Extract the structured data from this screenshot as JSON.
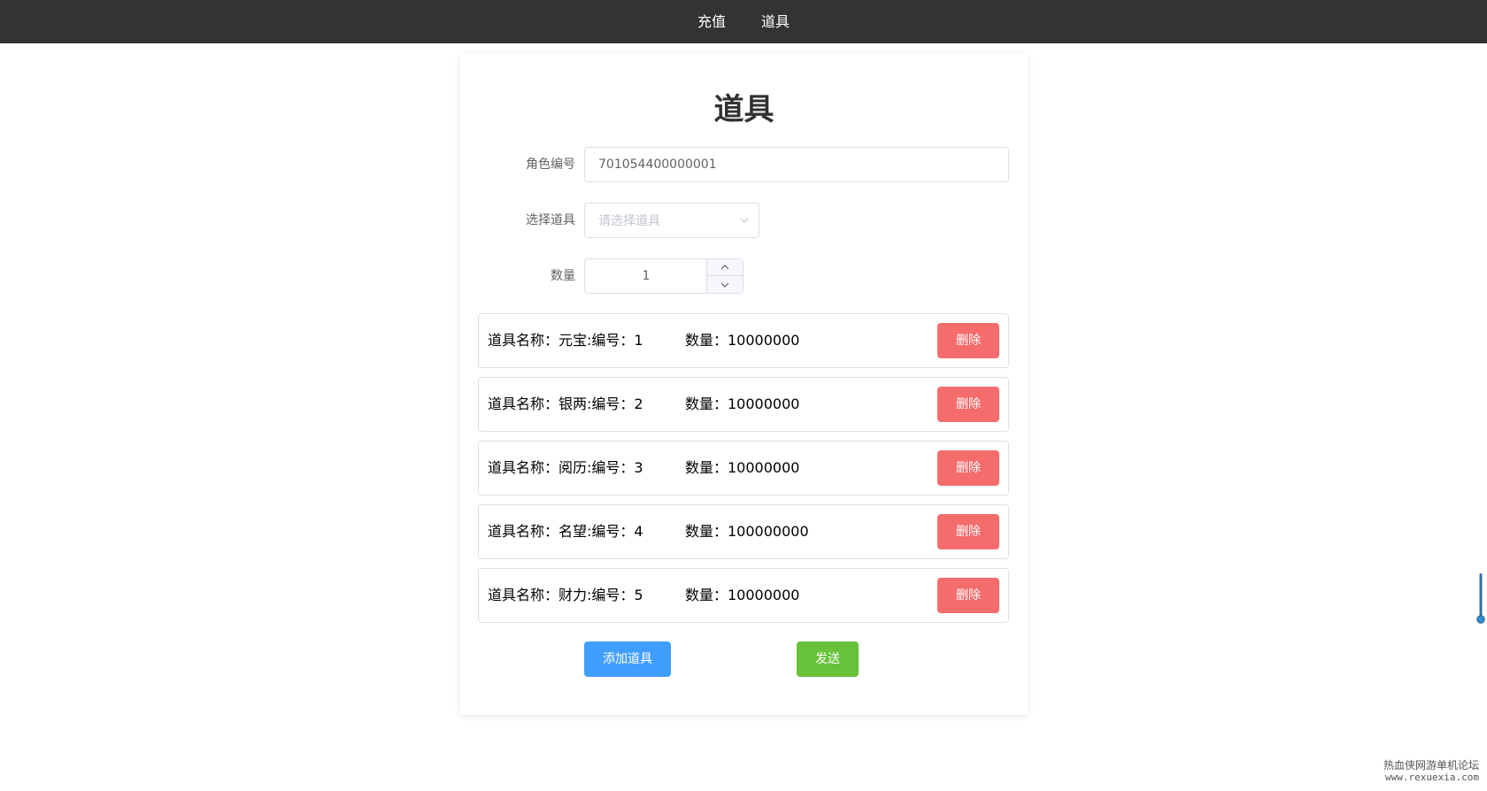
{
  "nav": {
    "items": [
      {
        "label": "充值"
      },
      {
        "label": "道具"
      }
    ]
  },
  "page": {
    "title": "道具"
  },
  "form": {
    "role_label": "角色编号",
    "role_value": "701054400000001",
    "prop_label": "选择道具",
    "prop_placeholder": "请选择道具",
    "qty_label": "数量",
    "qty_value": "1"
  },
  "items": [
    {
      "name": "道具名称：元宝:编号：1",
      "qty": "数量：10000000",
      "delete_label": "删除"
    },
    {
      "name": "道具名称：银两:编号：2",
      "qty": "数量：10000000",
      "delete_label": "删除"
    },
    {
      "name": "道具名称：阅历:编号：3",
      "qty": "数量：10000000",
      "delete_label": "删除"
    },
    {
      "name": "道具名称：名望:编号：4",
      "qty": "数量：100000000",
      "delete_label": "删除"
    },
    {
      "name": "道具名称：财力:编号：5",
      "qty": "数量：10000000",
      "delete_label": "删除"
    }
  ],
  "actions": {
    "add_label": "添加道具",
    "send_label": "发送"
  },
  "watermark": {
    "line1": "热血侠网游单机论坛",
    "line2": "www.rexuexia.com"
  },
  "colors": {
    "nav_bg": "#333333",
    "danger": "#f56c6c",
    "primary": "#409eff",
    "success": "#67c23a"
  },
  "icons": {
    "select": "chevron-down-icon",
    "step_up": "chevron-up-icon",
    "step_down": "chevron-down-icon",
    "scroll": "scroll-handle-icon"
  }
}
